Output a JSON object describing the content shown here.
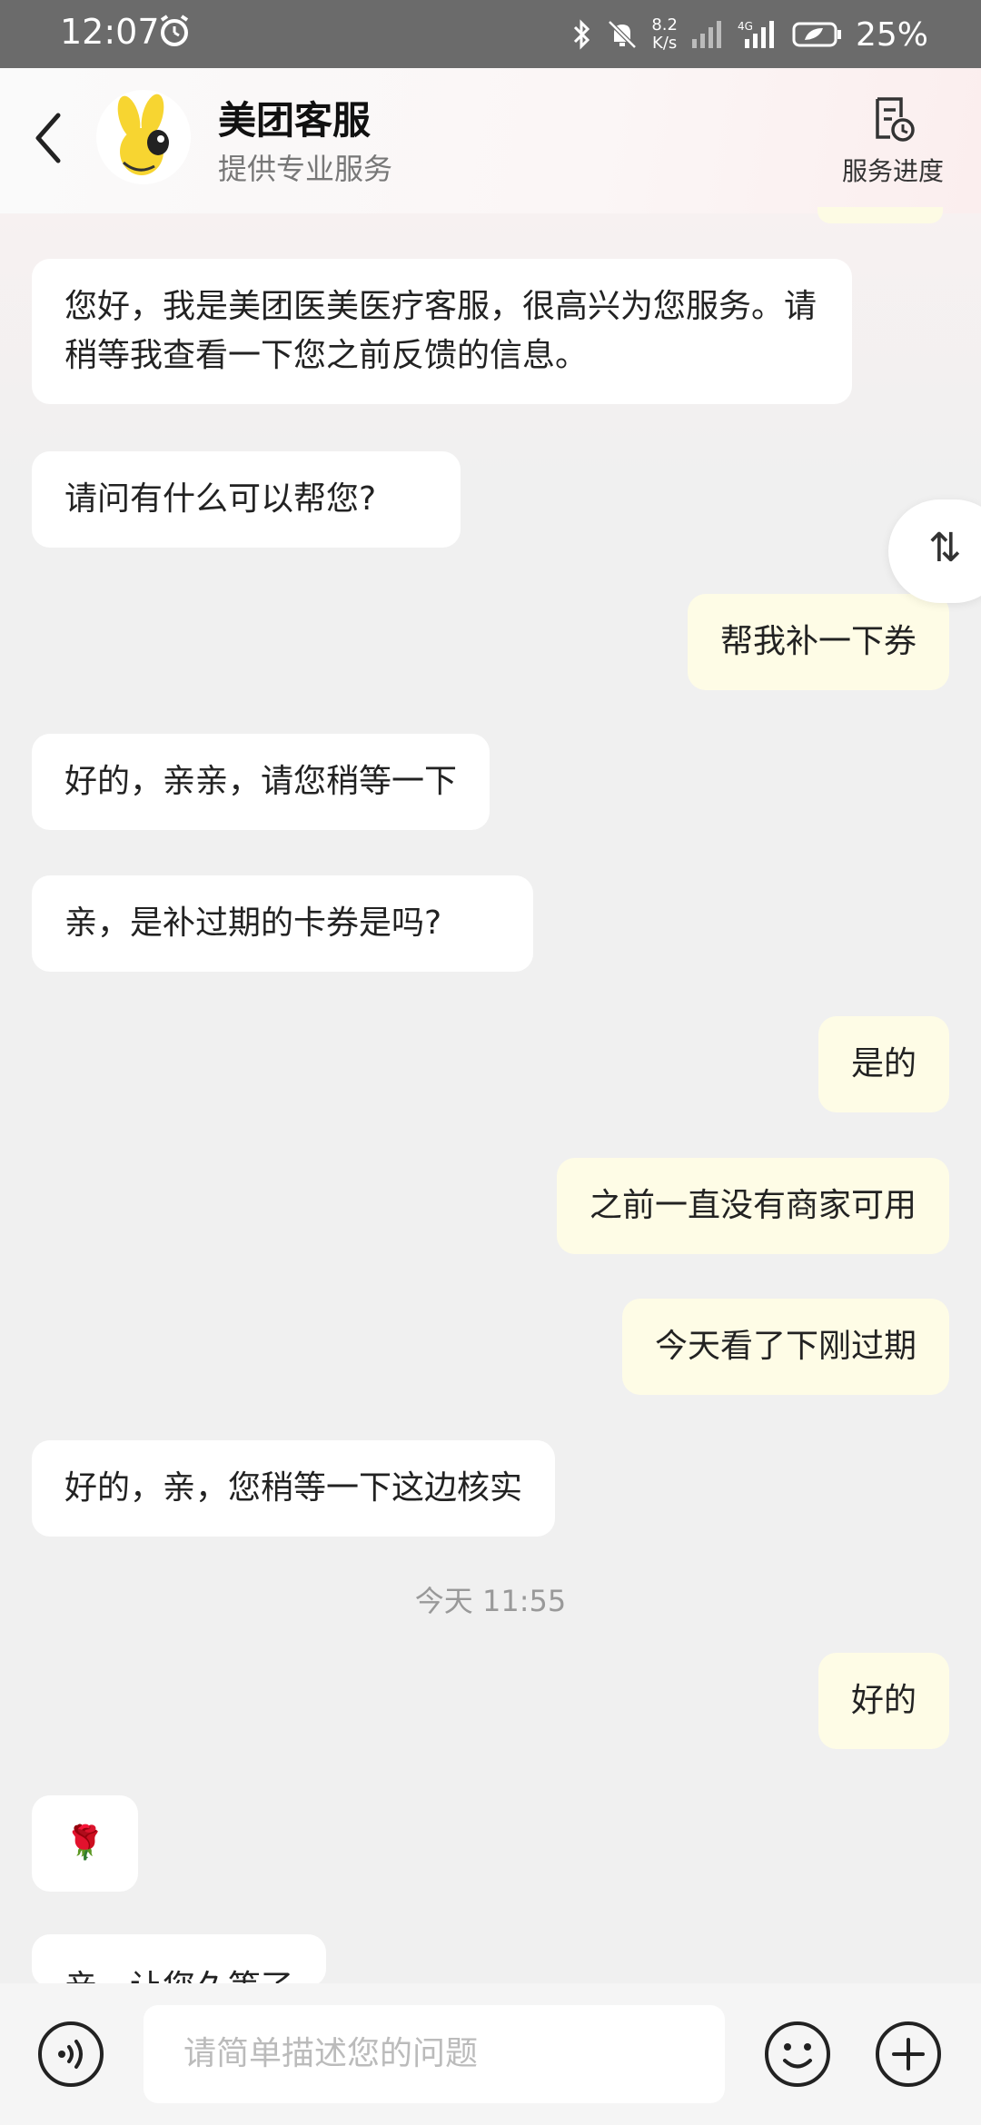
{
  "status_bar": {
    "time": "12:07",
    "network_speed_top": "8.2",
    "network_speed_bottom": "K/s",
    "battery": "25%"
  },
  "header": {
    "title": "美团客服",
    "subtitle": "提供专业服务",
    "progress_label": "服务进度"
  },
  "messages": [
    {
      "side": "left",
      "text": "您好，我是美团医美医疗客服，很高兴为您服务。请稍等我查看一下您之前反馈的信息。"
    },
    {
      "side": "left",
      "text": "请问有什么可以帮您?"
    },
    {
      "side": "right",
      "text": "帮我补一下券"
    },
    {
      "side": "left",
      "text": "好的，亲亲，请您稍等一下"
    },
    {
      "side": "left",
      "text": "亲，是补过期的卡券是吗?"
    },
    {
      "side": "right",
      "text": "是的"
    },
    {
      "side": "right",
      "text": "之前一直没有商家可用"
    },
    {
      "side": "right",
      "text": "今天看了下刚过期"
    },
    {
      "side": "left",
      "text": "好的，亲，您稍等一下这边核实"
    },
    {
      "side": "right",
      "text": "好的"
    },
    {
      "side": "left",
      "text": "🌹"
    },
    {
      "side": "left",
      "text": "亲，让您久等了"
    }
  ],
  "time_separator": "今天 11:55",
  "flip_button": "⇅",
  "input": {
    "placeholder": "请简单描述您的问题"
  },
  "colors": {
    "bubble_left": "#ffffff",
    "bubble_right": "#fefce6",
    "mascot_yellow": "#f7d531"
  },
  "icons": [
    "back-icon",
    "mascot-avatar",
    "service-progress-icon",
    "voice-icon",
    "emoji-icon",
    "plus-icon"
  ]
}
